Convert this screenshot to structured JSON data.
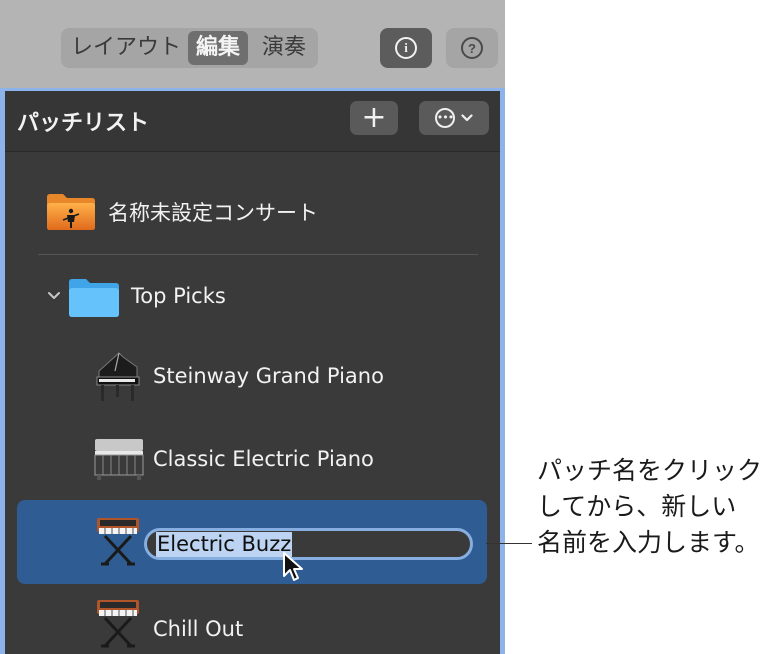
{
  "toolbar": {
    "tabs": [
      "レイアウト",
      "編集",
      "演奏"
    ],
    "selected_tab": "編集",
    "info_icon": "info-circle-icon",
    "help_icon": "question-circle-icon",
    "info_glyph": "i",
    "help_glyph": "?"
  },
  "patch_list": {
    "title": "パッチリスト",
    "add_label": "+",
    "more_icon": "ellipsis-circle-icon",
    "more_glyph": "•••",
    "concert": {
      "name": "名称未設定コンサート",
      "icon": "concert-folder-icon"
    },
    "folder": {
      "name": "Top Picks",
      "icon": "folder-icon",
      "expanded": true
    },
    "patches": [
      {
        "name": "Steinway Grand Piano",
        "icon": "grand-piano-icon"
      },
      {
        "name": "Classic Electric Piano",
        "icon": "electric-piano-icon"
      },
      {
        "name": "Electric Buzz",
        "icon": "synth-keyboard-icon",
        "selected": true,
        "editing": true
      },
      {
        "name": "Chill Out",
        "icon": "synth-keyboard-icon"
      }
    ]
  },
  "callout": {
    "lines": [
      "パッチ名をクリック",
      "してから、新しい",
      "名前を入力します。"
    ]
  },
  "colors": {
    "toolbar_bg": "#b4b4b4",
    "panel_bg": "#3a3a3a",
    "panel_border": "#8db3ea",
    "selection": "#2f5d93",
    "folder_blue": "#5ab8f5",
    "concert_orange": "#f08b2c"
  }
}
